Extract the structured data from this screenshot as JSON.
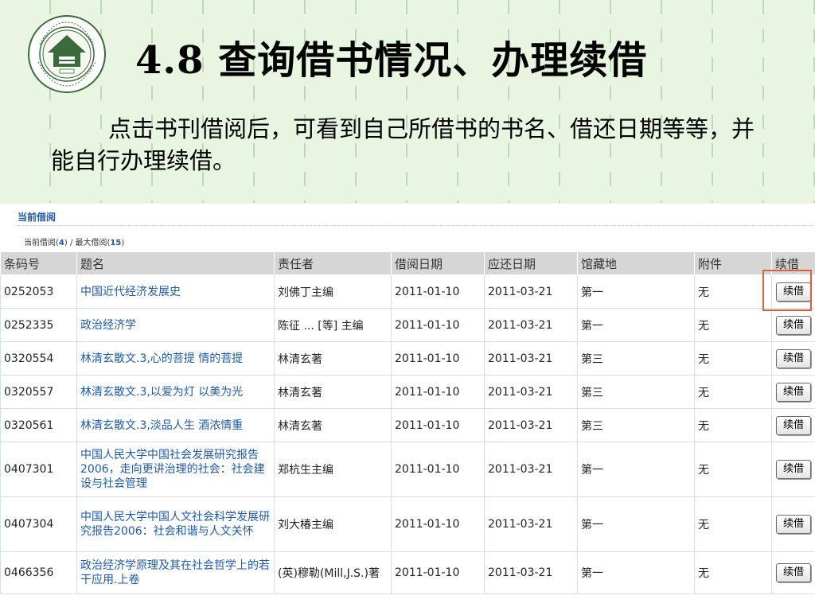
{
  "slide": {
    "title": "4.8  查询借书情况、办理续借",
    "description": "点击书刊借阅后，可看到自己所借书的书名、借还日期等等，并能自行办理续借。"
  },
  "panel": {
    "heading": "当前借阅",
    "current_label": "当前借阅(",
    "current_count": "4",
    "max_label": ") / 最大借阅(",
    "max_count": "15",
    "close_paren": ")"
  },
  "table": {
    "headers": [
      "条码号",
      "题名",
      "责任者",
      "借阅日期",
      "应还日期",
      "馆藏地",
      "附件",
      "续借"
    ],
    "renew_label": "续借",
    "rows": [
      {
        "barcode": "0252053",
        "title": "中国近代经济发展史",
        "author": "刘佛丁主编",
        "borrow": "2011-01-10",
        "due": "2011-03-21",
        "location": "第一",
        "attachment": "无"
      },
      {
        "barcode": "0252335",
        "title": "政治经济学",
        "author": "陈征 ... [等] 主编",
        "borrow": "2011-01-10",
        "due": "2011-03-21",
        "location": "第一",
        "attachment": "无"
      },
      {
        "barcode": "0320554",
        "title": "林清玄散文.3,心的菩提 情的菩提",
        "author": "林清玄著",
        "borrow": "2011-01-10",
        "due": "2011-03-21",
        "location": "第三",
        "attachment": "无"
      },
      {
        "barcode": "0320557",
        "title": "林清玄散文.3,以爱为灯 以美为光",
        "author": "林清玄著",
        "borrow": "2011-01-10",
        "due": "2011-03-21",
        "location": "第三",
        "attachment": "无"
      },
      {
        "barcode": "0320561",
        "title": "林清玄散文.3,淡品人生 酒浓情重",
        "author": "林清玄著",
        "borrow": "2011-01-10",
        "due": "2011-03-21",
        "location": "第三",
        "attachment": "无"
      },
      {
        "barcode": "0407301",
        "title": "中国人民大学中国社会发展研究报告2006，走向更讲治理的社会：社会建设与社会管理",
        "author": "郑杭生主编",
        "borrow": "2011-01-10",
        "due": "2011-03-21",
        "location": "第一",
        "attachment": "无"
      },
      {
        "barcode": "0407304",
        "title": "中国人民大学中国人文社会科学发展研究报告2006：社会和谐与人文关怀",
        "author": "刘大椿主编",
        "borrow": "2011-01-10",
        "due": "2011-03-21",
        "location": "第一",
        "attachment": "无"
      },
      {
        "barcode": "0466356",
        "title": "政治经济学原理及其在社会哲学上的若干应用.上卷",
        "author": "(英)穆勒(Mill,J.S.)著",
        "borrow": "2011-01-10",
        "due": "2011-03-21",
        "location": "第一",
        "attachment": "无"
      }
    ]
  },
  "colors": {
    "slide_background": "#e8f5e0",
    "link": "#1f5aa8",
    "highlight": "#d9603a",
    "header_background": "#d6d6d6"
  },
  "icons": [
    "school-seal-logo"
  ]
}
